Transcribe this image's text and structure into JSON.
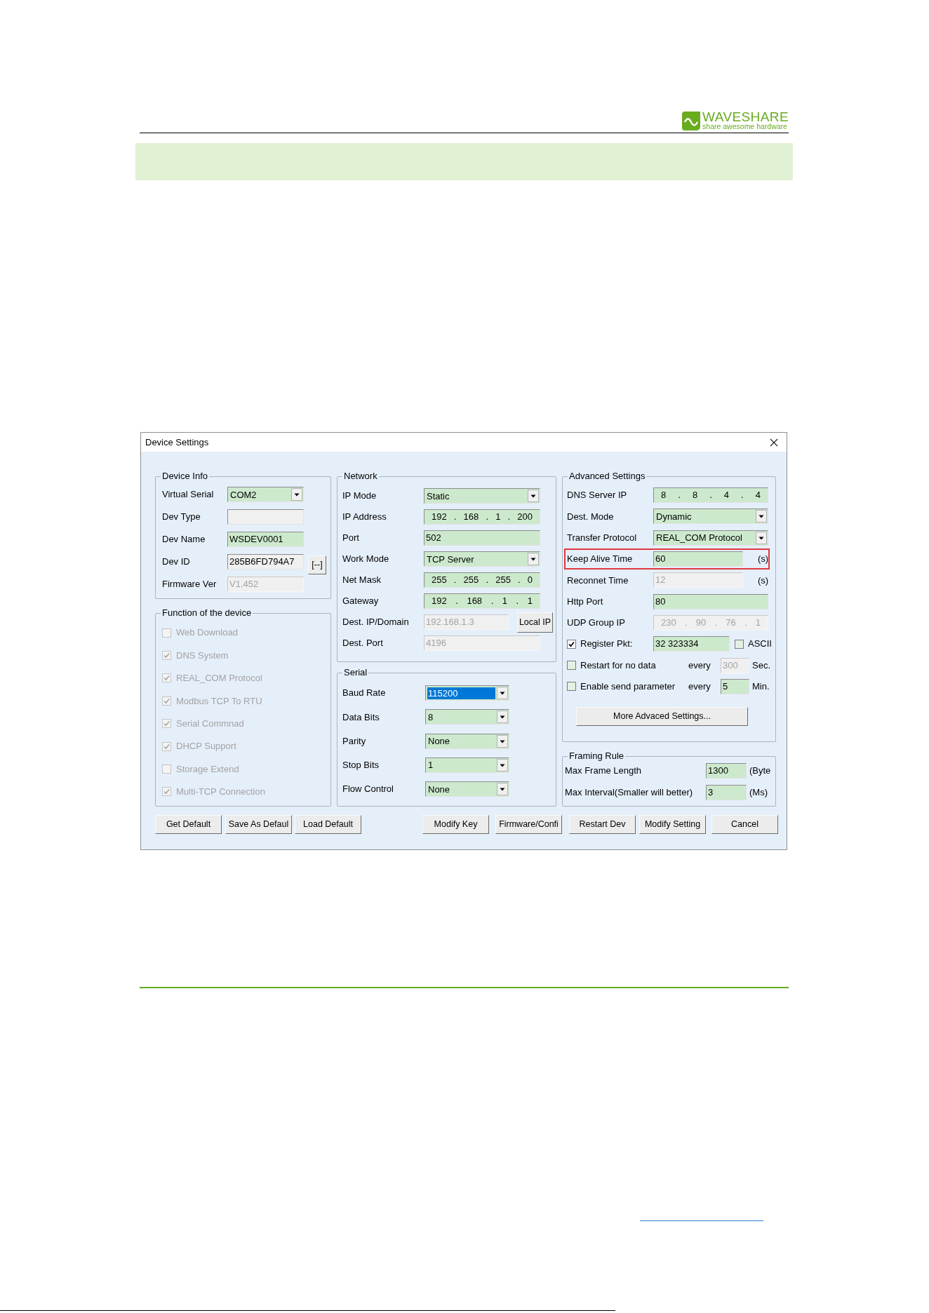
{
  "header": {
    "logo": {
      "name": "WAVESHARE",
      "tagline": "share awesome hardware"
    }
  },
  "dialog": {
    "title": "Device Settings",
    "device_info": {
      "title": "Device Info",
      "rows": [
        {
          "label": "Virtual Serial",
          "field": {
            "kind": "combo",
            "value": "COM2",
            "disabled": false,
            "highlighted": false
          }
        },
        {
          "label": "Dev Type",
          "field": {
            "kind": "readonly",
            "disabled": false
          }
        },
        {
          "label": "Dev Name",
          "field": {
            "kind": "edit",
            "value": "WSDEV0001",
            "disabled": false
          }
        },
        {
          "label": "Dev ID",
          "field": {
            "kind": "readonly",
            "value": "285B6FD794A7",
            "disabled": false
          },
          "button": "[--]"
        },
        {
          "label": "Firmware Ver",
          "field": {
            "kind": "readonly",
            "value": "V1.452",
            "disabled": true
          }
        }
      ]
    },
    "functions": {
      "title": "Function of the device",
      "items": [
        {
          "label": "Web Download",
          "checked": false,
          "disabled": true
        },
        {
          "label": "DNS System",
          "checked": true,
          "disabled": true
        },
        {
          "label": "REAL_COM Protocol",
          "checked": true,
          "disabled": true
        },
        {
          "label": "Modbus TCP To RTU",
          "checked": true,
          "disabled": true
        },
        {
          "label": "Serial Commnad",
          "checked": true,
          "disabled": true
        },
        {
          "label": "DHCP Support",
          "checked": true,
          "disabled": true
        },
        {
          "label": "Storage Extend",
          "checked": false,
          "disabled": true
        },
        {
          "label": "Multi-TCP Connection",
          "checked": true,
          "disabled": true
        }
      ]
    },
    "network": {
      "title": "Network",
      "rows": [
        {
          "label": "IP Mode",
          "field": {
            "kind": "combo",
            "value": "Static",
            "disabled": false,
            "highlighted": false
          }
        },
        {
          "label": "IP Address",
          "field": {
            "kind": "ip",
            "value": "192 . 168 . 1 . 200",
            "disabled": false
          }
        },
        {
          "label": "Port",
          "field": {
            "kind": "edit",
            "value": "502",
            "disabled": false
          }
        },
        {
          "label": "Work Mode",
          "field": {
            "kind": "combo",
            "value": "TCP Server",
            "disabled": false,
            "highlighted": false
          }
        },
        {
          "label": "Net Mask",
          "field": {
            "kind": "ip",
            "value": "255 . 255 . 255 . 0",
            "disabled": false
          }
        },
        {
          "label": "Gateway",
          "field": {
            "kind": "ip",
            "value": "192 . 168 . 1 . 1",
            "disabled": false
          }
        },
        {
          "label": "Dest. IP/Domain",
          "field": {
            "kind": "edit",
            "value": "192.168.1.3",
            "disabled": true
          },
          "button": "Local IP"
        },
        {
          "label": "Dest. Port",
          "field": {
            "kind": "edit",
            "value": "4196",
            "disabled": true
          }
        }
      ]
    },
    "serial": {
      "title": "Serial",
      "rows": [
        {
          "label": "Baud Rate",
          "field": {
            "kind": "combo",
            "value": "115200",
            "disabled": false,
            "highlighted": true
          }
        },
        {
          "label": "Data Bits",
          "field": {
            "kind": "combo",
            "value": "8",
            "disabled": false,
            "highlighted": false
          }
        },
        {
          "label": "Parity",
          "field": {
            "kind": "combo",
            "value": "None",
            "disabled": false,
            "highlighted": false
          }
        },
        {
          "label": "Stop Bits",
          "field": {
            "kind": "combo",
            "value": "1",
            "disabled": false,
            "highlighted": false
          }
        },
        {
          "label": "Flow Control",
          "field": {
            "kind": "combo",
            "value": "None",
            "disabled": false,
            "highlighted": false
          }
        }
      ]
    },
    "advanced": {
      "title": "Advanced Settings",
      "rows": [
        {
          "kind": "field",
          "label": "DNS Server IP",
          "field": {
            "kind": "ip",
            "value": "8 . 8 . 4 . 4",
            "disabled": false
          },
          "outlined": false
        },
        {
          "kind": "field",
          "label": "Dest. Mode",
          "field": {
            "kind": "combo",
            "value": "Dynamic",
            "disabled": false,
            "highlighted": false
          },
          "outlined": false
        },
        {
          "kind": "field",
          "label": "Transfer Protocol",
          "field": {
            "kind": "combo",
            "value": "REAL_COM Protocol",
            "disabled": false,
            "highlighted": false
          },
          "outlined": false
        },
        {
          "kind": "field",
          "label": "Keep Alive Time",
          "field": {
            "kind": "edit",
            "value": "60",
            "disabled": false
          },
          "unit": "(s)",
          "outlined": true
        },
        {
          "kind": "field",
          "label": "Reconnet Time",
          "field": {
            "kind": "edit",
            "value": "12",
            "disabled": true
          },
          "unit": "(s)",
          "outlined": false
        },
        {
          "kind": "field",
          "label": "Http Port",
          "field": {
            "kind": "edit",
            "value": "80",
            "disabled": false
          },
          "outlined": false
        },
        {
          "kind": "field",
          "label": "UDP Group IP",
          "field": {
            "kind": "ip",
            "value": "230 . 90 . 76 . 1",
            "disabled": true
          },
          "outlined": false
        },
        {
          "kind": "check",
          "label": "Register Pkt:",
          "checked": true,
          "field": {
            "kind": "edit",
            "value": "32 323334",
            "disabled": false
          },
          "extra_check": {
            "label": "ASCII",
            "checked": false
          },
          "outlined": false
        },
        {
          "kind": "check",
          "label": "Restart for no data",
          "checked": false,
          "prefix": "every",
          "field": {
            "kind": "edit",
            "value": "300",
            "disabled": true
          },
          "unit": "Sec.",
          "outlined": false
        },
        {
          "kind": "check",
          "label": "Enable send parameter",
          "checked": false,
          "prefix": "every",
          "field": {
            "kind": "edit",
            "value": "5",
            "disabled": false
          },
          "unit": "Min.",
          "outlined": false
        }
      ],
      "button": "More Advaced Settings..."
    },
    "framing": {
      "title": "Framing Rule",
      "rows": [
        {
          "label": "Max Frame Length",
          "field": {
            "kind": "edit",
            "value": "1300",
            "disabled": false
          },
          "unit": "(Byte"
        },
        {
          "label": "Max Interval(Smaller will better)",
          "field": {
            "kind": "edit",
            "value": "3",
            "disabled": false
          },
          "unit": "(Ms)"
        }
      ]
    },
    "buttons": [
      "Get Default",
      "Save As Defaul",
      "Load Default",
      "Modify Key",
      "Firmware/Confi",
      "Restart Dev",
      "Modify Setting",
      "Cancel"
    ]
  }
}
